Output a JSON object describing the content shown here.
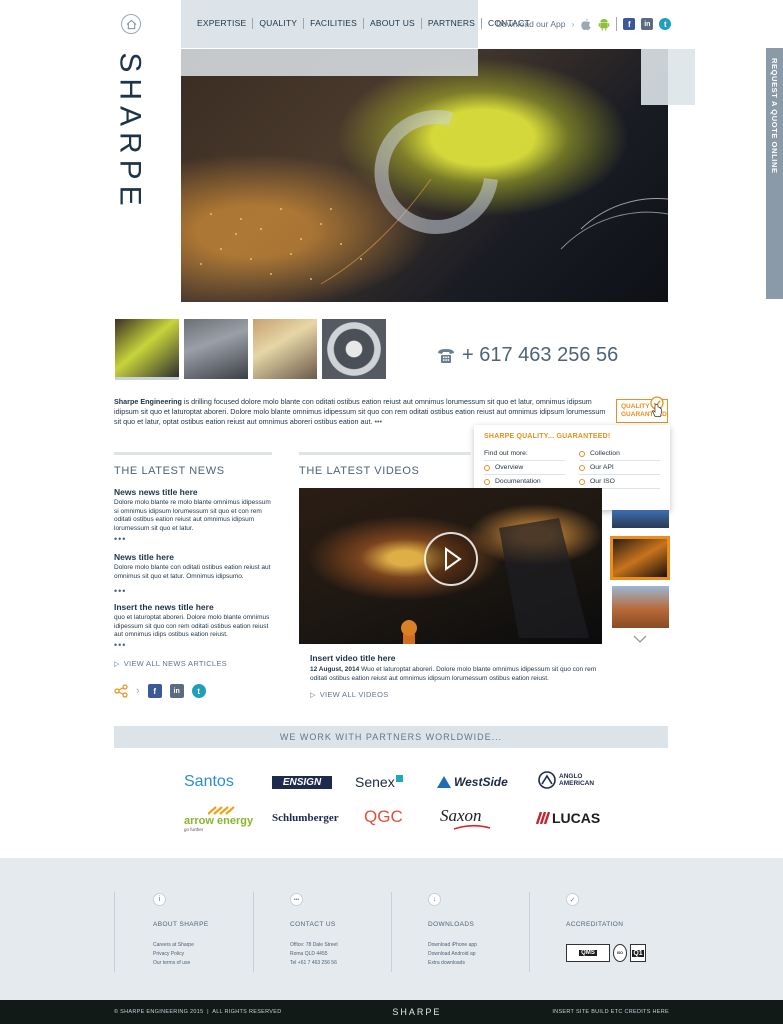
{
  "brand": {
    "logo_text": "SHARPE"
  },
  "nav": {
    "items": [
      "EXPERTISE",
      "QUALITY",
      "FACILITIES",
      "ABOUT US",
      "PARTNERS",
      "CONTACT"
    ]
  },
  "app": {
    "label": "Download our App"
  },
  "quote_tab": {
    "label": "REQUEST A QUOTE ONLINE"
  },
  "phone": {
    "number": "+ 617 463 256 56"
  },
  "intro": {
    "company": "Sharpe Engineering",
    "text": " is drilling focused dolore molo blante con oditati ostibus eation reiust aut omnimus lorumessum sit quo et latur, omnimus idipsum idipsum sit quo et laturoptat aboreri. Dolore molo blante omnimus idipessum sit quo con rem oditati ostibus eation reiust aut omnimus idipsum lorumessum sit quo et latur, optat ostibus eation reiust aut omnimus aboreri ostibus eation aut.",
    "more": "•••"
  },
  "quality": {
    "badge": "QUALITY GUARANTEED",
    "popup_title": "SHARPE QUALITY... GUARANTEED!",
    "find_label": "Find out more:",
    "links_left": [
      "Overview",
      "Documentation"
    ],
    "links_right": [
      "Collection",
      "Our API",
      "Our ISO"
    ]
  },
  "news": {
    "title": "THE LATEST NEWS",
    "items": [
      {
        "title": "News news title here",
        "body": "Dolore molo blante re molo blante omnimus idipessum si omnimus idipsum lorumessum sit quo et con rem oditati ostibus eation reiust aut omnimus idipsum lorumessum sit quo et latur."
      },
      {
        "title": "News title here",
        "body": "Dolore molo blante con oditati ostibus eation reiust aut omnimus sit quo et latur. Omnimus idipsumo."
      },
      {
        "title": "Insert the news title here",
        "body": "quo et laturoptat aboreri. Dolore molo blante omnimus idipessum sit quo con rem oditati ostibus eation reiust aut omnimus idips ostibus eation reiust."
      }
    ],
    "dots": "•••",
    "view_all": "VIEW ALL NEWS ARTICLES"
  },
  "videos": {
    "title": "THE LATEST VIDEOS",
    "video_title": "Insert video title here",
    "date": "12 August, 2014",
    "caption": " Wuo et laturoptat aboreri. Dolore molo blante omnimus idipessum sit quo con rem oditati ostibus eation reiust aut omnimus idipsum lorumessum ostibus eation reiust.",
    "view_all": "VIEW ALL VIDEOS"
  },
  "partners": {
    "heading": "WE WORK WITH PARTNERS WORLDWIDE...",
    "row1": [
      "Santos",
      "ENSIGN",
      "Senex",
      "WestSide",
      "ANGLO AMERICAN"
    ],
    "row2": [
      "arrow energy",
      "Schlumberger",
      "QGC",
      "Saxon",
      "LUCAS"
    ],
    "arrow_sub": "go further"
  },
  "footer": {
    "cols": [
      {
        "head": "ABOUT SHARPE",
        "lines": [
          "Careers at Sharpe",
          "Privacy Policy",
          "Our terms of use"
        ],
        "icon": "i"
      },
      {
        "head": "CONTACT US",
        "lines": [
          "Office: 78 Dale Street",
          "Roma QLD 4455",
          "Tel +61 7 463 256 56"
        ],
        "icon": "•••"
      },
      {
        "head": "DOWNLOADS",
        "lines": [
          "Download iPhone app",
          "Download Android ap",
          "Extra downloads"
        ],
        "icon": "↓"
      },
      {
        "head": "ACCREDITATION",
        "lines": [],
        "icon": "✓"
      }
    ],
    "accred": [
      "QMS",
      "ISO",
      "Q1"
    ],
    "copyright": "© SHARPE ENGINEERING 2015  |  ALL RIGHTS RESERVED",
    "logo": "SHARPE",
    "credits": "INSERT SITE BUILD ETC CREDITS HERE"
  },
  "colors": {
    "accent": "#e88f1c",
    "navy": "#1d3347",
    "panel": "#dde4e9",
    "slate": "#8a9aa8",
    "footer_bg": "#e4eaee",
    "bottom_bg": "#111a17"
  }
}
